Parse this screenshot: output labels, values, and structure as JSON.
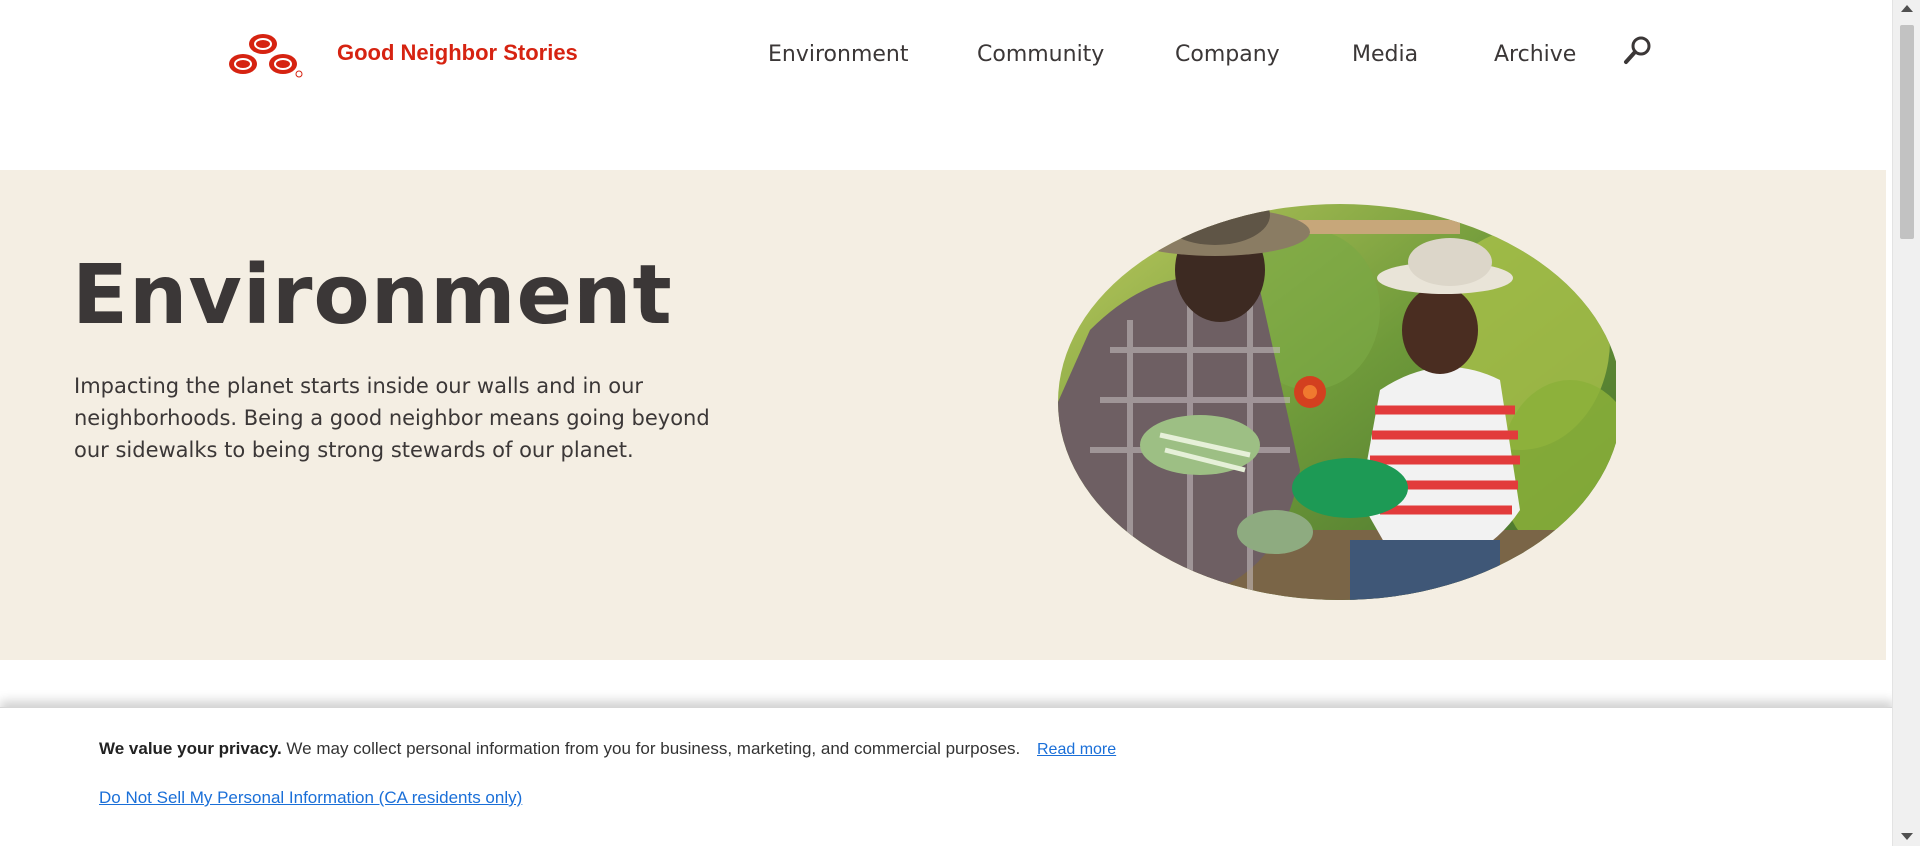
{
  "header": {
    "brand": "Good Neighbor Stories",
    "nav": [
      "Environment",
      "Community",
      "Company",
      "Media",
      "Archive"
    ],
    "search_icon": "search-icon",
    "brand_color": "#d62311"
  },
  "hero": {
    "title": "Environment",
    "description": "Impacting the planet starts inside our walls and in our neighborhoods. Being a good neighbor means going beyond our sidewalks to being strong stewards of our planet.",
    "background": "#f4eee3"
  },
  "privacy": {
    "heading": "We value your privacy.",
    "message": " We may collect personal information from you for business, marketing, and commercial purposes.",
    "read_more": "Read more",
    "do_not_sell": "Do Not Sell My Personal Information (CA residents only)",
    "link_color": "#1a6fd8"
  }
}
